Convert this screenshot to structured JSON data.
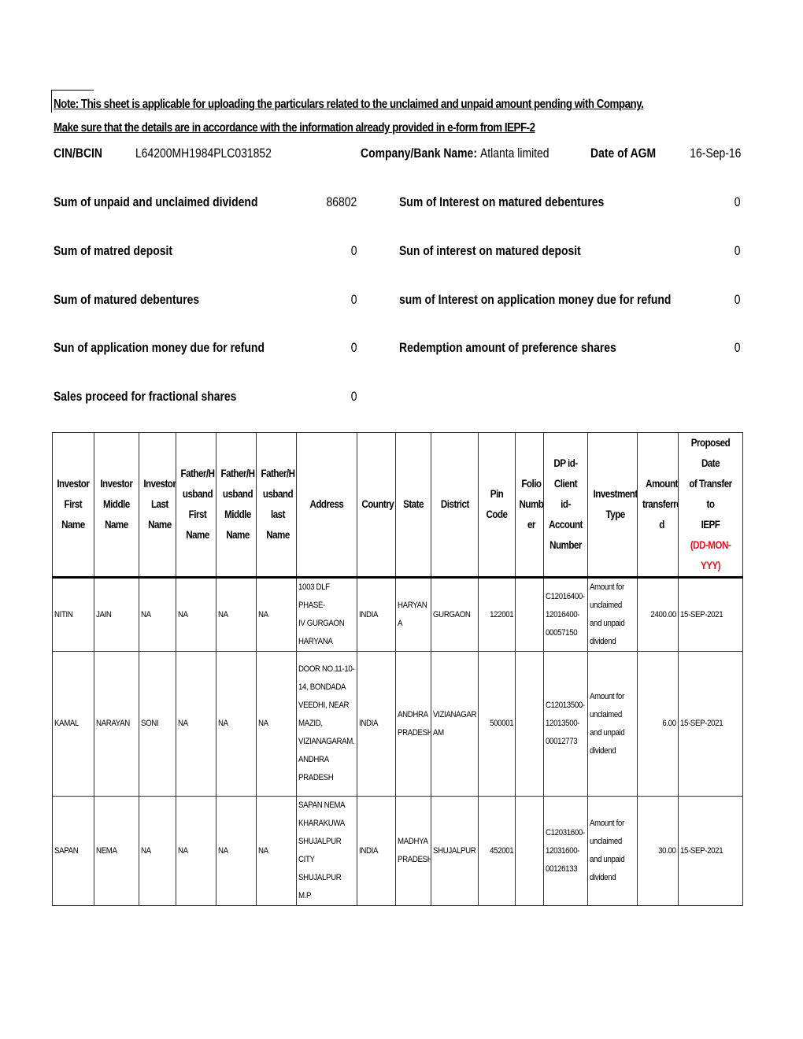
{
  "note": {
    "line1": "Note: This sheet is applicable for uploading the particulars related to the unclaimed and unpaid amount pending with Company.",
    "line2": "Make sure that the details are in accordance with the information already provided in e-form from IEPF-2"
  },
  "company_info": {
    "cin_label": "CIN/BCIN",
    "cin_value": "L64200MH1984PLC031852",
    "company_label": "Company/Bank Name:",
    "company_value": "Atlanta limited",
    "agm_label": "Date of AGM",
    "agm_value": "16-Sep-16"
  },
  "sums_left": [
    {
      "label": "Sum of unpaid and unclaimed dividend",
      "value": "86802"
    },
    {
      "label": "Sum of matred deposit",
      "value": "0"
    },
    {
      "label": "Sum of matured debentures",
      "value": "0"
    },
    {
      "label": "Sun of application money due for refund",
      "value": "0"
    },
    {
      "label": "Sales proceed for fractional shares",
      "value": "0"
    }
  ],
  "sums_right": [
    {
      "label": "Sum of Interest on matured debentures",
      "value": "0"
    },
    {
      "label": "Sun of interest on matured deposit",
      "value": "0"
    },
    {
      "label": "sum of Interest on application money due for refund",
      "value": "0"
    },
    {
      "label": "Redemption amount of preference shares",
      "value": "0"
    }
  ],
  "table": {
    "headers": [
      "Investor\nFirst\nName",
      "Investor\nMiddle\nName",
      "Investor\nLast\nName",
      "Father/H\nusband\nFirst\nName",
      "Father/H\nusband\nMiddle\nName",
      "Father/H\nusband\nlast\nName",
      "Address",
      "Country",
      "State",
      "District",
      "Pin Code",
      "Folio\nNumb\ner",
      "DP id-\nClient id-\nAccount\nNumber",
      "Investment\nType",
      "Amount\ntransferre\nd",
      "Proposed Date\nof Transfer to\nIEPF"
    ],
    "date_format_hint": "(DD-MON-YYY)",
    "hint_color": "#e0161b",
    "rows": [
      {
        "first": "NITIN",
        "middle": "JAIN",
        "last": "NA",
        "fh_first": "NA",
        "fh_middle": "NA",
        "fh_last": "NA",
        "address": "1003 DLF PHASE-\nIV  GURGAON\nHARYANA",
        "country": "INDIA",
        "state": "HARYAN\nA",
        "district": "GURGAON",
        "pin": "122001",
        "folio": "",
        "dp_id": "C12016400-\n12016400-\n00057150",
        "type": "Amount for\nunclaimed\nand unpaid\ndividend",
        "amount": "2400.00",
        "date": "15-SEP-2021"
      },
      {
        "first": "KAMAL",
        "middle": "NARAYAN",
        "last": "SONI",
        "fh_first": "NA",
        "fh_middle": "NA",
        "fh_last": "NA",
        "address": "DOOR NO.11-10-\n14, BONDADA\nVEEDHI, NEAR\nMAZID,\nVIZIANAGARAM.\nANDHRA\nPRADESH",
        "country": "INDIA",
        "state": "ANDHRA\nPRADESH",
        "district": "VIZIANAGAR\nAM",
        "pin": "500001",
        "folio": "",
        "dp_id": "C12013500-\n12013500-\n00012773",
        "type": "Amount for\nunclaimed\nand unpaid\ndividend",
        "amount": "6.00",
        "date": "15-SEP-2021"
      },
      {
        "first": "SAPAN",
        "middle": "NEMA",
        "last": "NA",
        "fh_first": "NA",
        "fh_middle": "NA",
        "fh_last": "NA",
        "address": "SAPAN NEMA\nKHARAKUWA\nSHUJALPUR CITY\nSHUJALPUR M.P",
        "country": "INDIA",
        "state": "MADHYA\nPRADESH",
        "district": "SHUJALPUR",
        "pin": "452001",
        "folio": "",
        "dp_id": "C12031600-\n12031600-\n00126133",
        "type": "Amount for\nunclaimed\nand unpaid\ndividend",
        "amount": "30.00",
        "date": "15-SEP-2021"
      }
    ]
  }
}
